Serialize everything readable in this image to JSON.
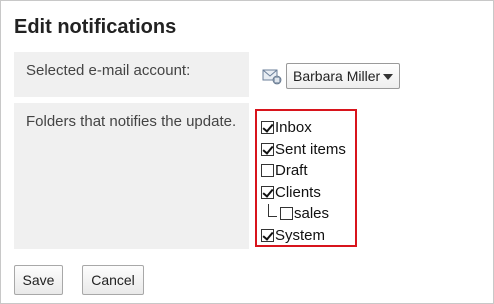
{
  "page": {
    "title": "Edit notifications"
  },
  "form": {
    "account_label": "Selected e-mail account:",
    "account_value": "Barbara Miller",
    "folders_label": "Folders that notifies the update."
  },
  "folders": [
    {
      "name": "Inbox",
      "checked": true,
      "child": false
    },
    {
      "name": "Sent items",
      "checked": true,
      "child": false
    },
    {
      "name": "Draft",
      "checked": false,
      "child": false
    },
    {
      "name": "Clients",
      "checked": true,
      "child": false
    },
    {
      "name": "sales",
      "checked": false,
      "child": true
    },
    {
      "name": "System",
      "checked": true,
      "child": false
    }
  ],
  "buttons": {
    "save": "Save",
    "cancel": "Cancel"
  },
  "colors": {
    "highlight_border": "#d8141c",
    "label_bg": "#f0f0f0"
  },
  "icons": {
    "account": "mail-account-icon",
    "dropdown": "chevron-down-icon"
  }
}
